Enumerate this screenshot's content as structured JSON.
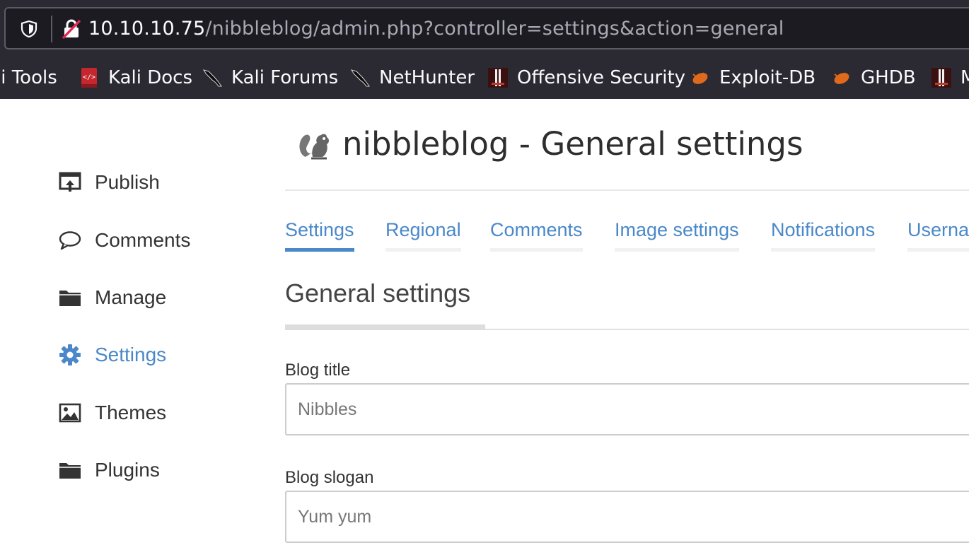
{
  "browser": {
    "url_host": "10.10.10.75",
    "url_path": "/nibbleblog/admin.php?controller=settings&action=general",
    "bookmarks": [
      {
        "label": "li Tools",
        "icon": "kali-tools-icon"
      },
      {
        "label": "Kali Docs",
        "icon": "kali-docs-icon"
      },
      {
        "label": "Kali Forums",
        "icon": "kali-dragon-icon"
      },
      {
        "label": "NetHunter",
        "icon": "kali-dragon-icon"
      },
      {
        "label": "Offensive Security",
        "icon": "offsec-icon"
      },
      {
        "label": "Exploit-DB",
        "icon": "exploit-db-icon"
      },
      {
        "label": "GHDB",
        "icon": "exploit-db-icon"
      },
      {
        "label": "M",
        "icon": "offsec-icon"
      }
    ]
  },
  "sidebar": {
    "items": [
      {
        "label": "Publish",
        "icon": "publish-icon",
        "active": false
      },
      {
        "label": "Comments",
        "icon": "comment-icon",
        "active": false
      },
      {
        "label": "Manage",
        "icon": "folder-icon",
        "active": false
      },
      {
        "label": "Settings",
        "icon": "gear-icon",
        "active": true
      },
      {
        "label": "Themes",
        "icon": "image-icon",
        "active": false
      },
      {
        "label": "Plugins",
        "icon": "folder-icon",
        "active": false
      }
    ],
    "accent_color": "#4a88c9"
  },
  "header": {
    "title": "nibbleblog - General settings"
  },
  "tabs": [
    {
      "label": "Settings",
      "active": true
    },
    {
      "label": "Regional",
      "active": false
    },
    {
      "label": "Comments",
      "active": false
    },
    {
      "label": "Image settings",
      "active": false
    },
    {
      "label": "Notifications",
      "active": false
    },
    {
      "label": "Userna",
      "active": false
    }
  ],
  "form": {
    "section_title": "General settings",
    "blog_title_label": "Blog title",
    "blog_title_value": "Nibbles",
    "blog_slogan_label": "Blog slogan",
    "blog_slogan_value": "Yum yum"
  }
}
